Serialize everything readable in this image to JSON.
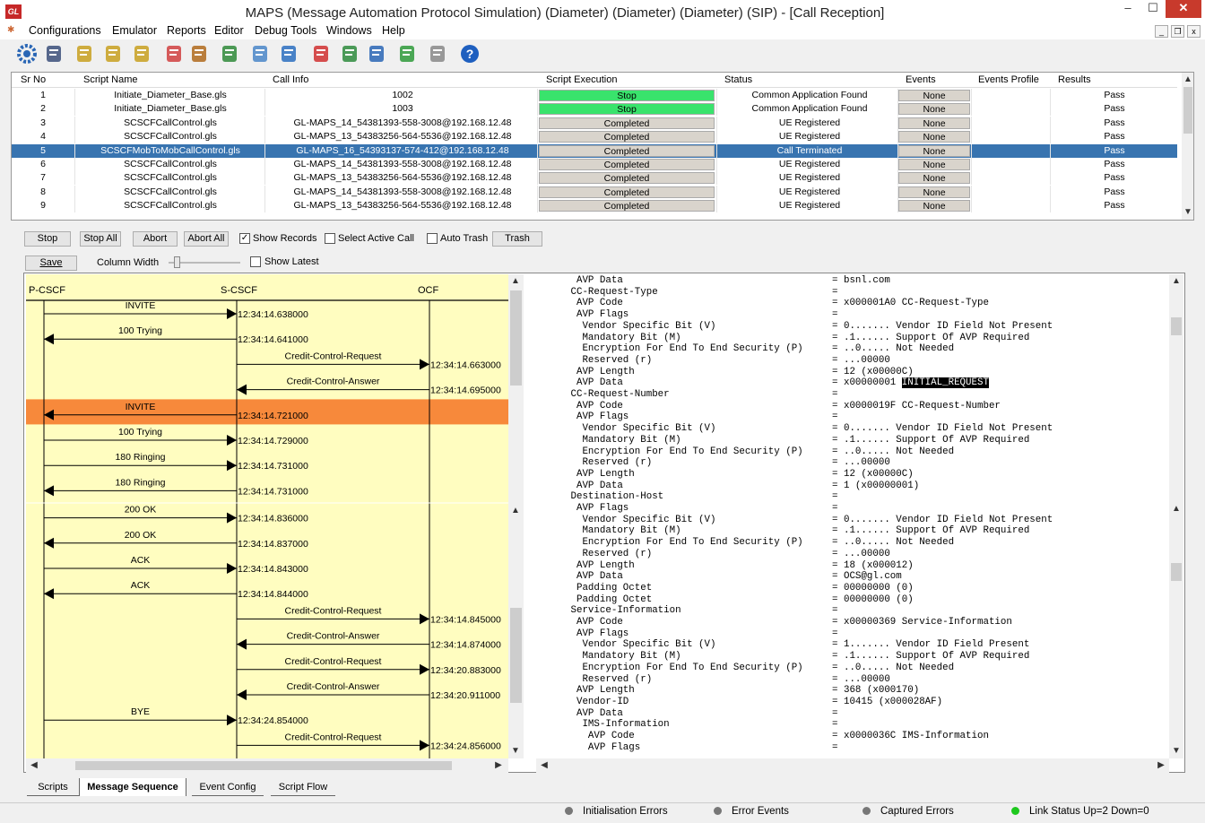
{
  "window": {
    "app_icon": "GL",
    "title": "MAPS (Message Automation Protocol Simulation) (Diameter) (Diameter) (Diameter) (SIP)  - [Call Reception]",
    "min": "‒",
    "max": "☐",
    "close": "✕"
  },
  "menu": {
    "items": [
      "Configurations",
      "Emulator",
      "Reports",
      "Editor",
      "Debug Tools",
      "Windows",
      "Help"
    ],
    "mdi_min": "_",
    "mdi_restore": "❐",
    "mdi_close": "x"
  },
  "toolbar": {
    "icons": [
      "gear-icon",
      "notebook-icon",
      "script-edit-icon",
      "profile-icon",
      "profile2-icon",
      "wrench-icon",
      "briefcase-icon",
      "lock-user-icon",
      "edit-check-icon",
      "settings-pen-icon",
      "doc-red-icon",
      "doc-green-icon",
      "doc-blue-icon",
      "transfer-icon",
      "doc-gray-icon",
      "help-icon"
    ],
    "colors": [
      "#2a66b5",
      "#3b4f7a",
      "#c8a020",
      "#c8a020",
      "#c8a020",
      "#d04040",
      "#b06a1c",
      "#2f8a3a",
      "#4a86c8",
      "#2b6fc0",
      "#d03030",
      "#2e8b3d",
      "#2a66b5",
      "#2e9a3a",
      "#888888",
      "#1e5fbf"
    ]
  },
  "grid": {
    "headers": [
      "Sr No",
      "Script Name",
      "Call Info",
      "Script Execution",
      "Status",
      "Events",
      "Events Profile",
      "Results"
    ],
    "rows": [
      {
        "sr": "1",
        "script": "Initiate_Diameter_Base.gls",
        "call": "1002",
        "exec": "Stop",
        "exec_color": "#39e36c",
        "status": "Common Application Found",
        "events": "None",
        "results": "Pass"
      },
      {
        "sr": "2",
        "script": "Initiate_Diameter_Base.gls",
        "call": "1003",
        "exec": "Stop",
        "exec_color": "#39e36c",
        "status": "Common Application Found",
        "events": "None",
        "results": "Pass"
      },
      {
        "sr": "3",
        "script": "SCSCFCallControl.gls",
        "call": "GL-MAPS_14_54381393-558-3008@192.168.12.48",
        "exec": "Completed",
        "exec_color": "#d9d4cc",
        "status": "UE Registered",
        "events": "None",
        "results": "Pass"
      },
      {
        "sr": "4",
        "script": "SCSCFCallControl.gls",
        "call": "GL-MAPS_13_54383256-564-5536@192.168.12.48",
        "exec": "Completed",
        "exec_color": "#d9d4cc",
        "status": "UE Registered",
        "events": "None",
        "results": "Pass"
      },
      {
        "sr": "5",
        "script": "SCSCFMobToMobCallControl.gls",
        "call": "GL-MAPS_16_54393137-574-412@192.168.12.48",
        "exec": "Completed",
        "exec_color": "#d9d4cc",
        "status": "Call Terminated",
        "events": "None",
        "results": "Pass",
        "selected": true
      },
      {
        "sr": "6",
        "script": "SCSCFCallControl.gls",
        "call": "GL-MAPS_14_54381393-558-3008@192.168.12.48",
        "exec": "Completed",
        "exec_color": "#d9d4cc",
        "status": "UE Registered",
        "events": "None",
        "results": "Pass"
      },
      {
        "sr": "7",
        "script": "SCSCFCallControl.gls",
        "call": "GL-MAPS_13_54383256-564-5536@192.168.12.48",
        "exec": "Completed",
        "exec_color": "#d9d4cc",
        "status": "UE Registered",
        "events": "None",
        "results": "Pass"
      },
      {
        "sr": "8",
        "script": "SCSCFCallControl.gls",
        "call": "GL-MAPS_14_54381393-558-3008@192.168.12.48",
        "exec": "Completed",
        "exec_color": "#d9d4cc",
        "status": "UE Registered",
        "events": "None",
        "results": "Pass"
      },
      {
        "sr": "9",
        "script": "SCSCFCallControl.gls",
        "call": "GL-MAPS_13_54383256-564-5536@192.168.12.48",
        "exec": "Completed",
        "exec_color": "#d9d4cc",
        "status": "UE Registered",
        "events": "None",
        "results": "Pass"
      }
    ]
  },
  "controls": {
    "stop": "Stop",
    "stop_all": "Stop All",
    "abort": "Abort",
    "abort_all": "Abort All",
    "show_records": "Show Records",
    "show_records_checked": true,
    "select_active": "Select Active Call",
    "select_active_checked": false,
    "auto_trash": "Auto Trash",
    "auto_trash_checked": false,
    "trash": "Trash"
  },
  "seq_controls": {
    "save": "Save",
    "column_width": "Column Width",
    "show_latest": "Show Latest",
    "show_latest_checked": false
  },
  "sequence": {
    "entities": [
      "P-CSCF",
      "S-CSCF",
      "OCF"
    ],
    "highlight_color": "#f7893b",
    "messages": [
      {
        "label": "INVITE",
        "time": "12:34:14.638000",
        "from": 0,
        "to": 1
      },
      {
        "label": "100  Trying",
        "time": "12:34:14.641000",
        "from": 1,
        "to": 0
      },
      {
        "label": "Credit-Control-Request",
        "time": "12:34:14.663000",
        "from": 1,
        "to": 2,
        "highlight": true
      },
      {
        "label": "Credit-Control-Answer",
        "time": "12:34:14.695000",
        "from": 2,
        "to": 1
      },
      {
        "label": "INVITE",
        "time": "12:34:14.721000",
        "from": 1,
        "to": 0
      },
      {
        "label": "100  Trying",
        "time": "12:34:14.729000",
        "from": 0,
        "to": 1
      },
      {
        "label": "180  Ringing",
        "time": "12:34:14.731000",
        "from": 0,
        "to": 1
      },
      {
        "label": "180  Ringing",
        "time": "12:34:14.731000",
        "from": 1,
        "to": 0
      },
      {
        "label": "200  OK",
        "time": "12:34:14.836000",
        "from": 0,
        "to": 1
      },
      {
        "label": "200  OK",
        "time": "12:34:14.837000",
        "from": 1,
        "to": 0
      },
      {
        "label": "ACK",
        "time": "12:34:14.843000",
        "from": 0,
        "to": 1
      },
      {
        "label": "ACK",
        "time": "12:34:14.844000",
        "from": 1,
        "to": 0
      },
      {
        "label": "Credit-Control-Request",
        "time": "12:34:14.845000",
        "from": 1,
        "to": 2
      },
      {
        "label": "Credit-Control-Answer",
        "time": "12:34:14.874000",
        "from": 2,
        "to": 1
      },
      {
        "label": "Credit-Control-Request",
        "time": "12:34:20.883000",
        "from": 1,
        "to": 2
      },
      {
        "label": "Credit-Control-Answer",
        "time": "12:34:20.911000",
        "from": 2,
        "to": 1
      },
      {
        "label": "BYE",
        "time": "12:34:24.854000",
        "from": 0,
        "to": 1
      },
      {
        "label": "Credit-Control-Request",
        "time": "12:34:24.856000",
        "from": 1,
        "to": 2
      }
    ]
  },
  "detail": {
    "lines": [
      {
        "f": "  AVP Data",
        "v": "= bsnl.com"
      },
      {
        "f": " CC-Request-Type",
        "v": "="
      },
      {
        "f": "  AVP Code",
        "v": "= x000001A0 CC-Request-Type"
      },
      {
        "f": "  AVP Flags",
        "v": "="
      },
      {
        "f": "   Vendor Specific Bit (V)",
        "v": "= 0....... Vendor ID Field Not Present"
      },
      {
        "f": "   Mandatory Bit (M)",
        "v": "= .1...... Support Of AVP Required"
      },
      {
        "f": "   Encryption For End To End Security (P)",
        "v": "= ..0..... Not Needed"
      },
      {
        "f": "   Reserved (r)",
        "v": "= ...00000"
      },
      {
        "f": "  AVP Length",
        "v": "= 12 (x00000C)"
      },
      {
        "f": "  AVP Data",
        "v": "= x00000001 ",
        "hl": "INITIAL_REQUEST"
      },
      {
        "f": " CC-Request-Number",
        "v": "="
      },
      {
        "f": "  AVP Code",
        "v": "= x0000019F CC-Request-Number"
      },
      {
        "f": "  AVP Flags",
        "v": "="
      },
      {
        "f": "   Vendor Specific Bit (V)",
        "v": "= 0....... Vendor ID Field Not Present"
      },
      {
        "f": "   Mandatory Bit (M)",
        "v": "= .1...... Support Of AVP Required"
      },
      {
        "f": "   Encryption For End To End Security (P)",
        "v": "= ..0..... Not Needed"
      },
      {
        "f": "   Reserved (r)",
        "v": "= ...00000"
      },
      {
        "f": "  AVP Length",
        "v": "= 12 (x00000C)"
      },
      {
        "f": "  AVP Data",
        "v": "= 1 (x00000001)"
      },
      {
        "f": " Destination-Host",
        "v": "="
      },
      {
        "f": "  AVP Flags",
        "v": "="
      },
      {
        "f": "   Vendor Specific Bit (V)",
        "v": "= 0....... Vendor ID Field Not Present"
      },
      {
        "f": "   Mandatory Bit (M)",
        "v": "= .1...... Support Of AVP Required"
      },
      {
        "f": "   Encryption For End To End Security (P)",
        "v": "= ..0..... Not Needed"
      },
      {
        "f": "   Reserved (r)",
        "v": "= ...00000"
      },
      {
        "f": "  AVP Length",
        "v": "= 18 (x000012)"
      },
      {
        "f": "  AVP Data",
        "v": "= OCS@gl.com"
      },
      {
        "f": "  Padding Octet",
        "v": "= 00000000 (0)"
      },
      {
        "f": "  Padding Octet",
        "v": "= 00000000 (0)"
      },
      {
        "f": " Service-Information",
        "v": "="
      },
      {
        "f": "  AVP Code",
        "v": "= x00000369 Service-Information"
      },
      {
        "f": "  AVP Flags",
        "v": "="
      },
      {
        "f": "   Vendor Specific Bit (V)",
        "v": "= 1....... Vendor ID Field Present"
      },
      {
        "f": "   Mandatory Bit (M)",
        "v": "= .1...... Support Of AVP Required"
      },
      {
        "f": "   Encryption For End To End Security (P)",
        "v": "= ..0..... Not Needed"
      },
      {
        "f": "   Reserved (r)",
        "v": "= ...00000"
      },
      {
        "f": "  AVP Length",
        "v": "= 368 (x000170)"
      },
      {
        "f": "  Vendor-ID",
        "v": "= 10415 (x000028AF)"
      },
      {
        "f": "  AVP Data",
        "v": "="
      },
      {
        "f": "   IMS-Information",
        "v": "="
      },
      {
        "f": "    AVP Code",
        "v": "= x0000036C IMS-Information"
      },
      {
        "f": "    AVP Flags",
        "v": "="
      }
    ]
  },
  "tabs": [
    "Scripts",
    "Message Sequence",
    "Event Config",
    "Script Flow"
  ],
  "active_tab": "Message Sequence",
  "status": {
    "init_errors": "Initialisation Errors",
    "error_events": "Error Events",
    "captured_errors": "Captured Errors",
    "link_status": "Link Status Up=2 Down=0",
    "gray": "#777777",
    "green": "#1ec81e"
  }
}
